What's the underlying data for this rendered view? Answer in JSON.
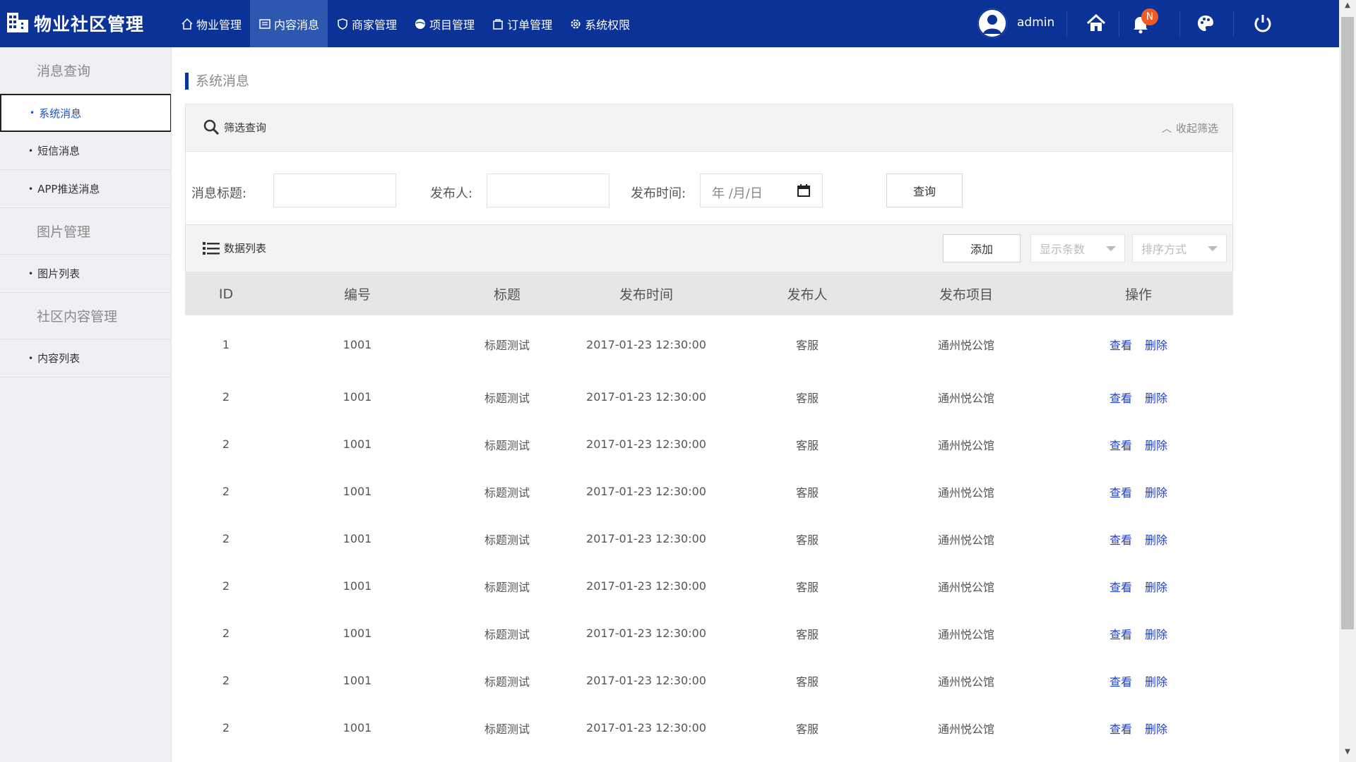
{
  "app": {
    "title": "物业社区管理"
  },
  "nav": [
    {
      "label": "物业管理",
      "icon": "house-icon"
    },
    {
      "label": "内容消息",
      "icon": "message-icon",
      "active": true
    },
    {
      "label": "商家管理",
      "icon": "shield-icon"
    },
    {
      "label": "项目管理",
      "icon": "globe-icon"
    },
    {
      "label": "订单管理",
      "icon": "bag-icon"
    },
    {
      "label": "系统权限",
      "icon": "gear-icon"
    }
  ],
  "header": {
    "username": "admin",
    "notification_badge": "N"
  },
  "sidebar": {
    "groups": [
      {
        "title": "消息查询",
        "items": [
          {
            "label": "系统消息",
            "active": true
          },
          {
            "label": "短信消息"
          },
          {
            "label": "APP推送消息"
          }
        ]
      },
      {
        "title": "图片管理",
        "items": [
          {
            "label": "图片列表"
          }
        ]
      },
      {
        "title": "社区内容管理",
        "items": [
          {
            "label": "内容列表"
          }
        ]
      }
    ]
  },
  "page": {
    "title": "系统消息"
  },
  "filter": {
    "panel_title": "筛选查询",
    "collapse_label": "收起筛选",
    "title_label": "消息标题:",
    "title_value": "",
    "publisher_label": "发布人:",
    "publisher_value": "",
    "time_label": "发布时间:",
    "time_placeholder": "年 /月/日",
    "query_button": "查询"
  },
  "list": {
    "panel_title": "数据列表",
    "add_button": "添加",
    "page_size_select": "显示条数",
    "sort_select": "排序方式",
    "columns": [
      "ID",
      "编号",
      "标题",
      "发布时间",
      "发布人",
      "发布项目",
      "操作"
    ],
    "view_label": "查看",
    "delete_label": "删除",
    "rows": [
      [
        "1",
        "1001",
        "标题测试",
        "2017-01-23  12:30:00",
        "客服",
        "通州悦公馆"
      ],
      [
        "2",
        "1001",
        "标题测试",
        "2017-01-23  12:30:00",
        "客服",
        "通州悦公馆"
      ],
      [
        "2",
        "1001",
        "标题测试",
        "2017-01-23  12:30:00",
        "客服",
        "通州悦公馆"
      ],
      [
        "2",
        "1001",
        "标题测试",
        "2017-01-23  12:30:00",
        "客服",
        "通州悦公馆"
      ],
      [
        "2",
        "1001",
        "标题测试",
        "2017-01-23  12:30:00",
        "客服",
        "通州悦公馆"
      ],
      [
        "2",
        "1001",
        "标题测试",
        "2017-01-23  12:30:00",
        "客服",
        "通州悦公馆"
      ],
      [
        "2",
        "1001",
        "标题测试",
        "2017-01-23  12:30:00",
        "客服",
        "通州悦公馆"
      ],
      [
        "2",
        "1001",
        "标题测试",
        "2017-01-23  12:30:00",
        "客服",
        "通州悦公馆"
      ],
      [
        "2",
        "1001",
        "标题测试",
        "2017-01-23  12:30:00",
        "客服",
        "通州悦公馆"
      ]
    ]
  },
  "colors": {
    "header_bg": "#0b3296",
    "nav_active": "#2e58b0",
    "link": "#1e3fc8",
    "badge": "#f15a22"
  }
}
